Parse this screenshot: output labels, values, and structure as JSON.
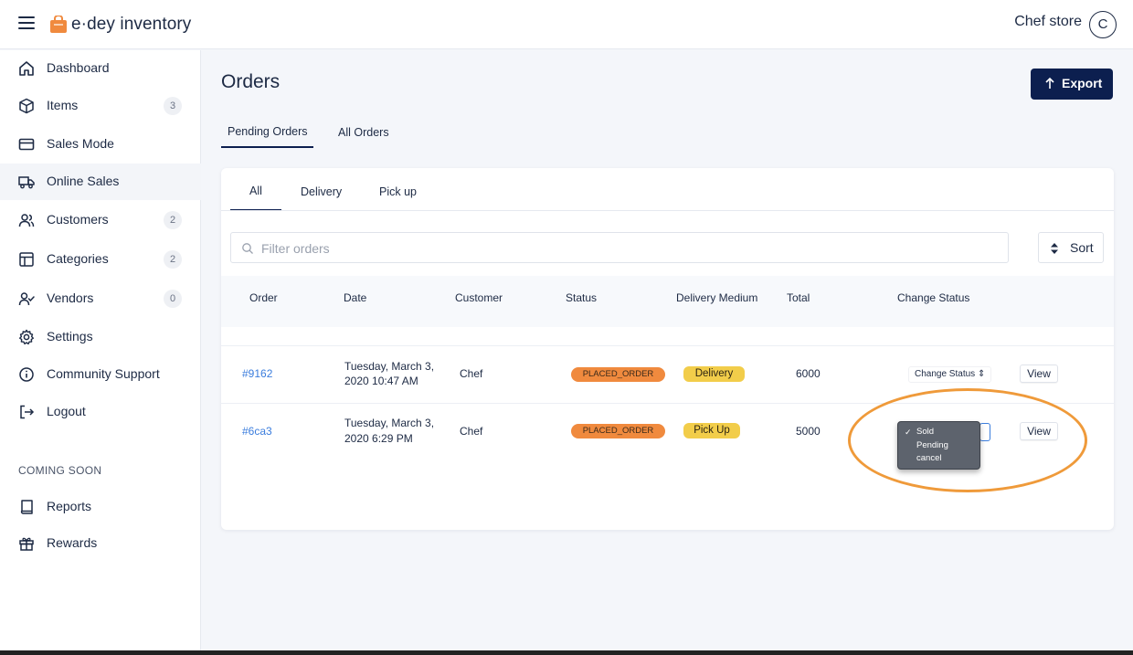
{
  "app": {
    "name": "e·dey inventory",
    "store_name": "Chef store",
    "avatar_initial": "C"
  },
  "sidebar": {
    "items": [
      {
        "label": "Dashboard",
        "icon": "home-icon",
        "badge": ""
      },
      {
        "label": "Items",
        "icon": "box-icon",
        "badge": "3"
      },
      {
        "label": "Sales Mode",
        "icon": "card-icon",
        "badge": ""
      },
      {
        "label": "Online Sales",
        "icon": "truck-icon",
        "badge": ""
      },
      {
        "label": "Customers",
        "icon": "users-icon",
        "badge": "2"
      },
      {
        "label": "Categories",
        "icon": "layout-icon",
        "badge": "2"
      },
      {
        "label": "Vendors",
        "icon": "user-check-icon",
        "badge": "0"
      },
      {
        "label": "Settings",
        "icon": "gear-icon",
        "badge": ""
      },
      {
        "label": "Community Support",
        "icon": "info-icon",
        "badge": ""
      },
      {
        "label": "Logout",
        "icon": "logout-icon",
        "badge": ""
      }
    ],
    "active_index": 3,
    "coming_soon_label": "COMING SOON",
    "coming_soon_items": [
      {
        "label": "Reports",
        "icon": "book-icon"
      },
      {
        "label": "Rewards",
        "icon": "gift-icon"
      }
    ]
  },
  "main": {
    "title": "Orders",
    "export_label": "Export",
    "tabs": [
      "Pending Orders",
      "All Orders"
    ],
    "active_tab": "Pending Orders",
    "subtabs": [
      "All",
      "Delivery",
      "Pick up"
    ],
    "active_subtab": "All",
    "filter_placeholder": "Filter orders",
    "sort_label": "Sort",
    "columns": [
      "Order",
      "Date",
      "Customer",
      "Status",
      "Delivery Medium",
      "Total",
      "Change Status"
    ],
    "rows": [
      {
        "order": "#9162",
        "date_line1": "Tuesday, March 3,",
        "date_line2": "2020 10:47 AM",
        "customer": "Chef",
        "status": "PLACED_ORDER",
        "medium": "Delivery",
        "total": "6000",
        "change_status": "Change Status",
        "view_label": "View"
      },
      {
        "order": "#6ca3",
        "date_line1": "Tuesday, March 3,",
        "date_line2": "2020 6:29 PM",
        "customer": "Chef",
        "status": "PLACED_ORDER",
        "medium": "Pick Up",
        "total": "5000",
        "change_status": "",
        "view_label": "View"
      }
    ],
    "status_dropdown": {
      "options": [
        "Sold",
        "Pending",
        "cancel"
      ],
      "selected": "Sold"
    }
  },
  "colors": {
    "primary": "#0c1f4f",
    "link": "#3b7ddd",
    "status_placed": "#f08a3e",
    "medium_badge": "#f2cd4a",
    "annotation": "#ef9a3a"
  }
}
